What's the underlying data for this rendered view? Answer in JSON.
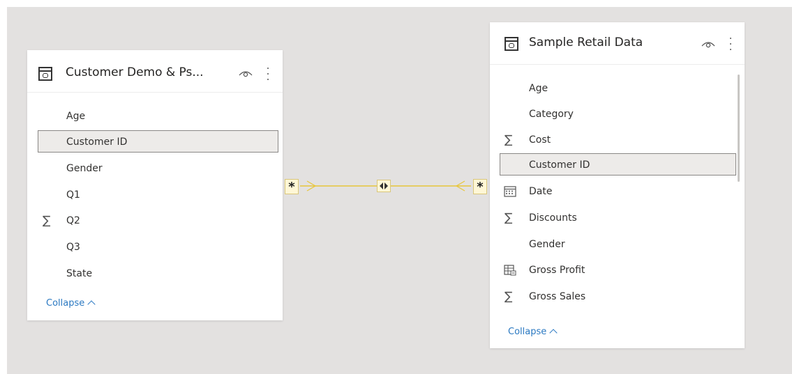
{
  "tables": [
    {
      "title": "Customer Demo & Ps...",
      "fields": [
        {
          "label": "Age",
          "icon": ""
        },
        {
          "label": "Customer ID",
          "icon": ""
        },
        {
          "label": "Gender",
          "icon": ""
        },
        {
          "label": "Q1",
          "icon": ""
        },
        {
          "label": "Q2",
          "icon": "sigma-icon"
        },
        {
          "label": "Q3",
          "icon": ""
        },
        {
          "label": "State",
          "icon": ""
        }
      ],
      "collapse_label": "Collapse"
    },
    {
      "title": "Sample Retail Data",
      "fields": [
        {
          "label": "Age",
          "icon": ""
        },
        {
          "label": "Category",
          "icon": ""
        },
        {
          "label": "Cost",
          "icon": "sigma-icon"
        },
        {
          "label": "Customer ID",
          "icon": ""
        },
        {
          "label": "Date",
          "icon": "calendar-icon"
        },
        {
          "label": "Discounts",
          "icon": "sigma-icon"
        },
        {
          "label": "Gender",
          "icon": ""
        },
        {
          "label": "Gross Profit",
          "icon": "calculated-column-icon"
        },
        {
          "label": "Gross Sales",
          "icon": "sigma-icon"
        }
      ],
      "collapse_label": "Collapse"
    }
  ],
  "selected_field": "Customer ID",
  "relationship": {
    "from_cardinality": "*",
    "to_cardinality": "*",
    "cross_filter": "both",
    "line_color": "#e8c63a"
  },
  "colors": {
    "canvas": "#e3e1e0",
    "card": "#ffffff",
    "link": "#2b79c2",
    "selected_bg": "#edebe9"
  }
}
